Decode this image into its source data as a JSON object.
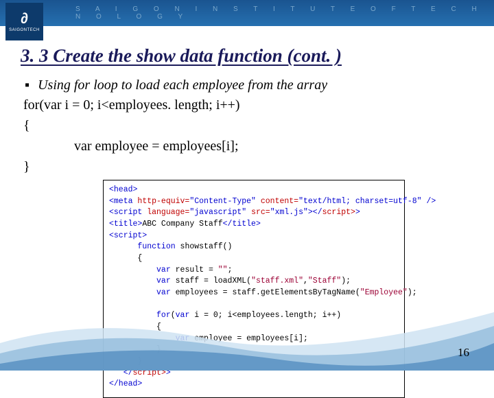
{
  "header": {
    "org_line": "S A I G O N   I N S T I T U T E   O F   T E C H N O L O G Y",
    "logo_label": "SAIGONTECH",
    "logo_symbol": "∂"
  },
  "title": "3. 3 Create the show data function (cont. )",
  "bullet": "Using for loop to load each employee from the array",
  "code": {
    "l1": "for(var i = 0; i<employees. length; i++)",
    "l2": "{",
    "l3": "var employee = employees[i];",
    "l4": "}"
  },
  "screenshot": {
    "head_open": "<head>",
    "meta": "<meta http-equiv=\"Content-Type\" content=\"text/html; charset=utf-8\" />",
    "script_xml": "<script language=\"javascript\" src=\"xml.js\"></",
    "script_close": "script>",
    "title_tag": "<title>ABC Company Staff</title>",
    "script_open": "<script>",
    "fn": "function showstaff()",
    "brace_o": "{",
    "r1": "var result = \"\";",
    "r2a": "var staff = loadXML(",
    "r2b": "\"staff.xml\"",
    "r2c": ",",
    "r2d": "\"Staff\"",
    "r2e": ");",
    "r3a": "var employees = staff.getElementsByTagName(",
    "r3b": "\"Employee\"",
    "r3c": ");",
    "r4": "for(var i = 0; i<employees.length; i++)",
    "r5": "{",
    "r6": "var employee = employees[i];",
    "r7": "}",
    "brace_c": "}",
    "script_end": "</",
    "script_end2": "script>",
    "head_close": "</head>"
  },
  "page_number": "16"
}
